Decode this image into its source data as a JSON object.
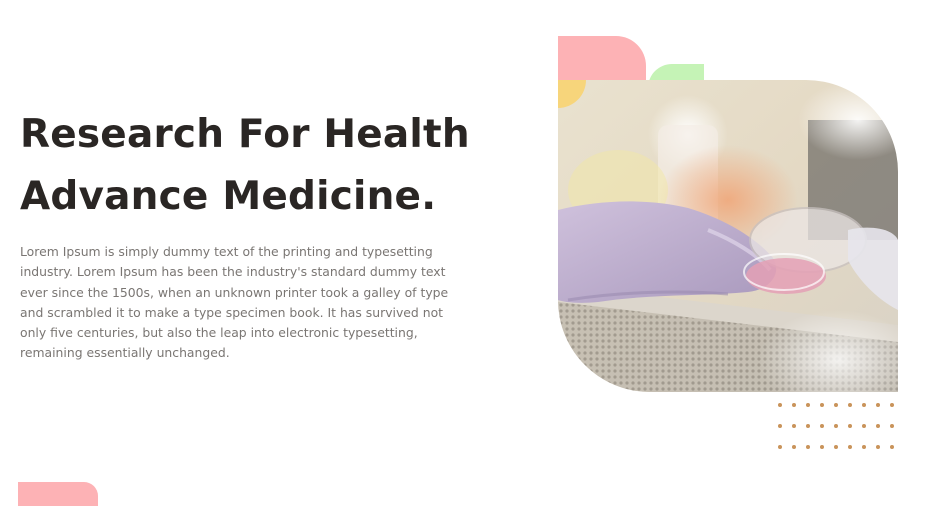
{
  "hero": {
    "heading_line1": "Research For Health",
    "heading_line2": "Advance Medicine.",
    "description": "Lorem Ipsum is simply dummy text of the printing and typesetting industry. Lorem Ipsum has been the industry's standard dummy text ever since the 1500s, when an unknown printer took a galley of type and scrambled it to make a type specimen book. It has survived not only five centuries, but also the leap into electronic typesetting, remaining essentially unchanged."
  },
  "colors": {
    "heading": "#2a2624",
    "body_text": "#7a7673",
    "accent_pink": "#fdb2b5",
    "accent_green": "#c5f3b6",
    "accent_yellow": "#f7d57b",
    "dots": "#c9935a"
  }
}
